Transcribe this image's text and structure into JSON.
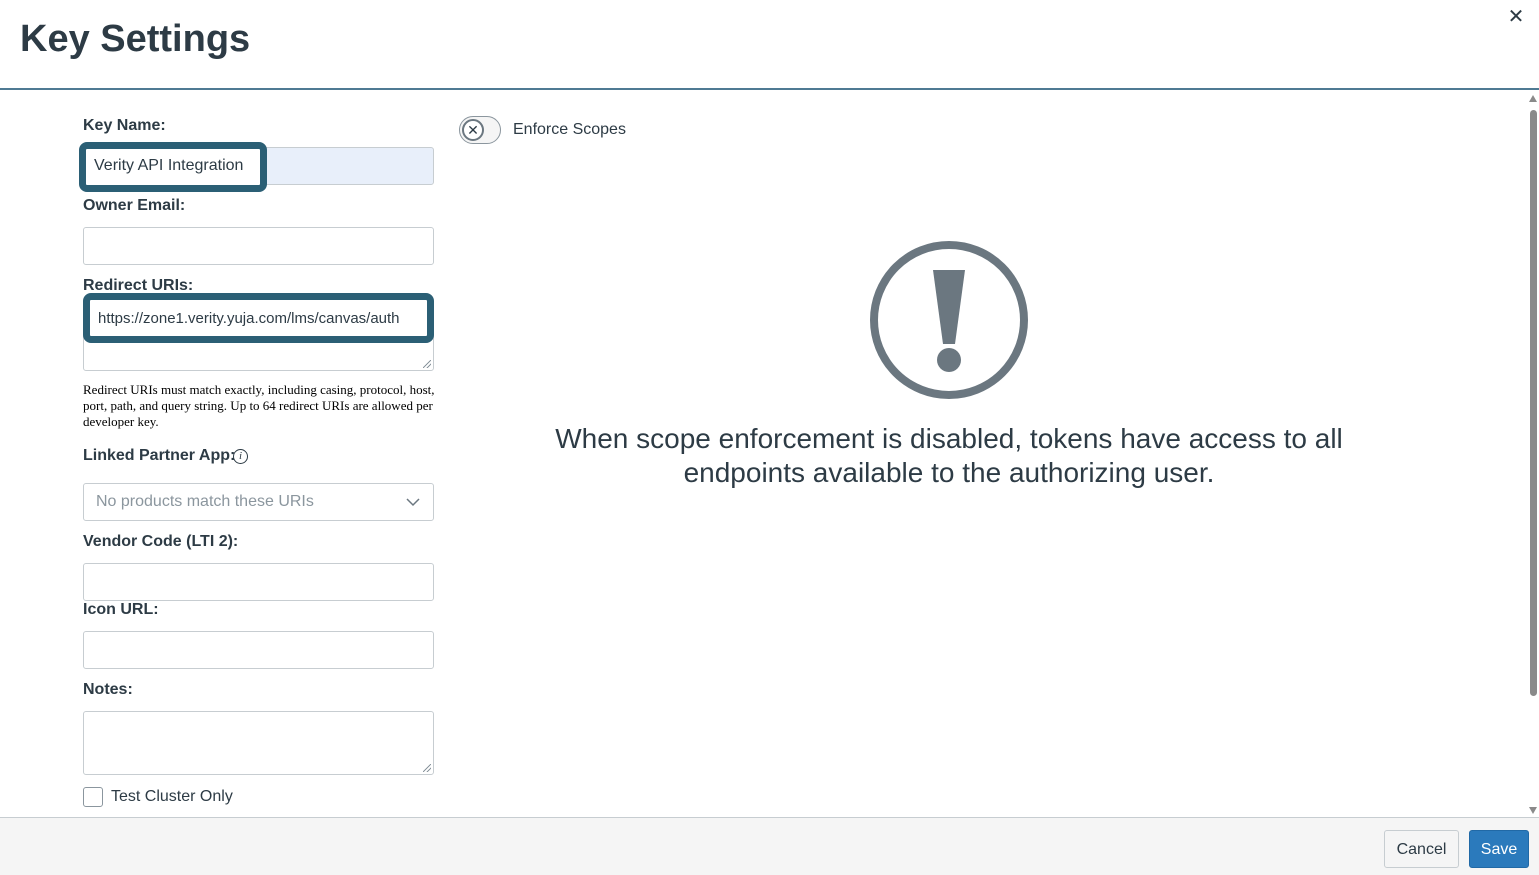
{
  "dialog": {
    "title": "Key Settings"
  },
  "form": {
    "key_name": {
      "label": "Key Name:",
      "value": "Verity API Integration"
    },
    "owner_email": {
      "label": "Owner Email:",
      "value": ""
    },
    "redirect_uris": {
      "label": "Redirect URIs:",
      "value": "https://zone1.verity.yuja.com/lms/canvas/auth",
      "help": "Redirect URIs must match exactly, including casing, protocol, host, port, path, and query string. Up to 64 redirect URIs are allowed per developer key."
    },
    "linked_partner_app": {
      "label": "Linked Partner App:",
      "placeholder": "No products match these URIs"
    },
    "vendor_code": {
      "label": "Vendor Code (LTI 2):",
      "value": ""
    },
    "icon_url": {
      "label": "Icon URL:",
      "value": ""
    },
    "notes": {
      "label": "Notes:",
      "value": ""
    },
    "test_cluster": {
      "label": "Test Cluster Only",
      "checked": false
    }
  },
  "scopes": {
    "toggle_label": "Enforce Scopes",
    "enabled": false,
    "message": "When scope enforcement is disabled, tokens have access to all endpoints available to the authorizing user."
  },
  "footer": {
    "cancel_label": "Cancel",
    "save_label": "Save"
  },
  "colors": {
    "highlight": "#2b5f75",
    "primary": "#2b7abc",
    "text": "#2d3b45"
  },
  "icons": {
    "close": "close-icon",
    "info": "info-icon",
    "chevron": "chevron-down-icon",
    "warning": "exclamation-circle-icon"
  }
}
